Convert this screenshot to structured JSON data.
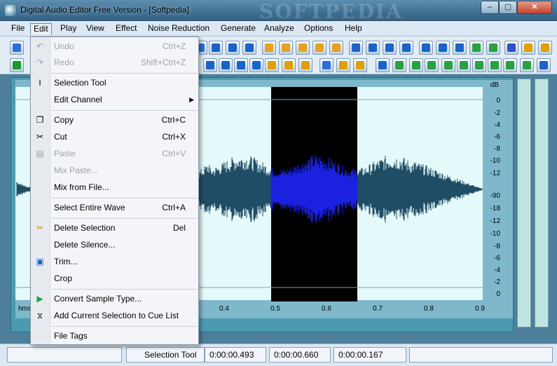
{
  "window": {
    "title": "Digital Audio Editor Free Version - [Softpedia]",
    "watermark": "SOFTPEDIA",
    "min_glyph": "‒",
    "max_glyph": "▢",
    "close_glyph": "✕"
  },
  "menubar": {
    "items": [
      "File",
      "Edit",
      "Play",
      "View",
      "Effect",
      "Noise Reduction",
      "Generate",
      "Analyze",
      "Options",
      "Help"
    ]
  },
  "edit_menu": {
    "undo": {
      "label": "Undo",
      "shortcut": "Ctrl+Z"
    },
    "redo": {
      "label": "Redo",
      "shortcut": "Shift+Ctrl+Z"
    },
    "selection_tool": {
      "label": "Selection Tool"
    },
    "edit_channel": {
      "label": "Edit Channel"
    },
    "copy": {
      "label": "Copy",
      "shortcut": "Ctrl+C"
    },
    "cut": {
      "label": "Cut",
      "shortcut": "Ctrl+X"
    },
    "paste": {
      "label": "Paste",
      "shortcut": "Ctrl+V"
    },
    "mix_paste": {
      "label": "Mix Paste..."
    },
    "mix_from_file": {
      "label": "Mix from File..."
    },
    "select_entire_wave": {
      "label": "Select Entire Wave",
      "shortcut": "Ctrl+A"
    },
    "delete_selection": {
      "label": "Delete Selection",
      "shortcut": "Del"
    },
    "delete_silence": {
      "label": "Delete Silence..."
    },
    "trim": {
      "label": "Trim..."
    },
    "crop": {
      "label": "Crop"
    },
    "convert_sample_type": {
      "label": "Convert Sample Type..."
    },
    "add_cue": {
      "label": "Add Current Selection to Cue List"
    },
    "file_tags": {
      "label": "File Tags"
    }
  },
  "wave": {
    "db_unit": "dB",
    "db_labels": [
      "0",
      "-2",
      "-4",
      "-6",
      "-8",
      "-10",
      "-12",
      "-90",
      "-18",
      "-12",
      "-10",
      "-8",
      "-6",
      "-4",
      "-2",
      "0"
    ],
    "time_ticks": [
      "0.4",
      "0.5",
      "0.6",
      "0.7",
      "0.8",
      "0.9"
    ],
    "time_unit": "hms",
    "colors": {
      "background": "#e4f9f9",
      "waveform": "#1f4d66",
      "selection_bg": "#000000",
      "selection_wave": "#1a22e0"
    }
  },
  "statusbar": {
    "tool": "Selection Tool",
    "sel_start": "0:00:00.493",
    "sel_end": "0:00:00.660",
    "sel_length": "0:00:00.167"
  }
}
